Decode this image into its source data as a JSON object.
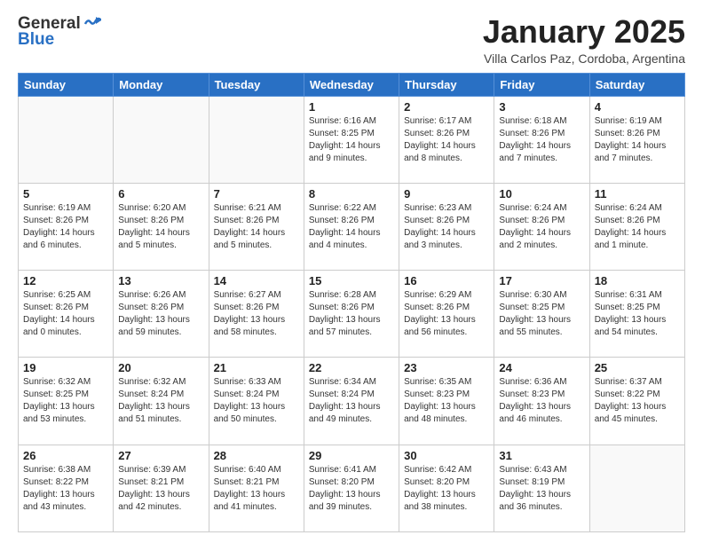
{
  "logo": {
    "general": "General",
    "blue": "Blue"
  },
  "header": {
    "month": "January 2025",
    "location": "Villa Carlos Paz, Cordoba, Argentina"
  },
  "days_of_week": [
    "Sunday",
    "Monday",
    "Tuesday",
    "Wednesday",
    "Thursday",
    "Friday",
    "Saturday"
  ],
  "weeks": [
    [
      {
        "day": "",
        "sunrise": "",
        "sunset": "",
        "daylight": ""
      },
      {
        "day": "",
        "sunrise": "",
        "sunset": "",
        "daylight": ""
      },
      {
        "day": "",
        "sunrise": "",
        "sunset": "",
        "daylight": ""
      },
      {
        "day": "1",
        "sunrise": "Sunrise: 6:16 AM",
        "sunset": "Sunset: 8:25 PM",
        "daylight": "Daylight: 14 hours and 9 minutes."
      },
      {
        "day": "2",
        "sunrise": "Sunrise: 6:17 AM",
        "sunset": "Sunset: 8:26 PM",
        "daylight": "Daylight: 14 hours and 8 minutes."
      },
      {
        "day": "3",
        "sunrise": "Sunrise: 6:18 AM",
        "sunset": "Sunset: 8:26 PM",
        "daylight": "Daylight: 14 hours and 7 minutes."
      },
      {
        "day": "4",
        "sunrise": "Sunrise: 6:19 AM",
        "sunset": "Sunset: 8:26 PM",
        "daylight": "Daylight: 14 hours and 7 minutes."
      }
    ],
    [
      {
        "day": "5",
        "sunrise": "Sunrise: 6:19 AM",
        "sunset": "Sunset: 8:26 PM",
        "daylight": "Daylight: 14 hours and 6 minutes."
      },
      {
        "day": "6",
        "sunrise": "Sunrise: 6:20 AM",
        "sunset": "Sunset: 8:26 PM",
        "daylight": "Daylight: 14 hours and 5 minutes."
      },
      {
        "day": "7",
        "sunrise": "Sunrise: 6:21 AM",
        "sunset": "Sunset: 8:26 PM",
        "daylight": "Daylight: 14 hours and 5 minutes."
      },
      {
        "day": "8",
        "sunrise": "Sunrise: 6:22 AM",
        "sunset": "Sunset: 8:26 PM",
        "daylight": "Daylight: 14 hours and 4 minutes."
      },
      {
        "day": "9",
        "sunrise": "Sunrise: 6:23 AM",
        "sunset": "Sunset: 8:26 PM",
        "daylight": "Daylight: 14 hours and 3 minutes."
      },
      {
        "day": "10",
        "sunrise": "Sunrise: 6:24 AM",
        "sunset": "Sunset: 8:26 PM",
        "daylight": "Daylight: 14 hours and 2 minutes."
      },
      {
        "day": "11",
        "sunrise": "Sunrise: 6:24 AM",
        "sunset": "Sunset: 8:26 PM",
        "daylight": "Daylight: 14 hours and 1 minute."
      }
    ],
    [
      {
        "day": "12",
        "sunrise": "Sunrise: 6:25 AM",
        "sunset": "Sunset: 8:26 PM",
        "daylight": "Daylight: 14 hours and 0 minutes."
      },
      {
        "day": "13",
        "sunrise": "Sunrise: 6:26 AM",
        "sunset": "Sunset: 8:26 PM",
        "daylight": "Daylight: 13 hours and 59 minutes."
      },
      {
        "day": "14",
        "sunrise": "Sunrise: 6:27 AM",
        "sunset": "Sunset: 8:26 PM",
        "daylight": "Daylight: 13 hours and 58 minutes."
      },
      {
        "day": "15",
        "sunrise": "Sunrise: 6:28 AM",
        "sunset": "Sunset: 8:26 PM",
        "daylight": "Daylight: 13 hours and 57 minutes."
      },
      {
        "day": "16",
        "sunrise": "Sunrise: 6:29 AM",
        "sunset": "Sunset: 8:26 PM",
        "daylight": "Daylight: 13 hours and 56 minutes."
      },
      {
        "day": "17",
        "sunrise": "Sunrise: 6:30 AM",
        "sunset": "Sunset: 8:25 PM",
        "daylight": "Daylight: 13 hours and 55 minutes."
      },
      {
        "day": "18",
        "sunrise": "Sunrise: 6:31 AM",
        "sunset": "Sunset: 8:25 PM",
        "daylight": "Daylight: 13 hours and 54 minutes."
      }
    ],
    [
      {
        "day": "19",
        "sunrise": "Sunrise: 6:32 AM",
        "sunset": "Sunset: 8:25 PM",
        "daylight": "Daylight: 13 hours and 53 minutes."
      },
      {
        "day": "20",
        "sunrise": "Sunrise: 6:32 AM",
        "sunset": "Sunset: 8:24 PM",
        "daylight": "Daylight: 13 hours and 51 minutes."
      },
      {
        "day": "21",
        "sunrise": "Sunrise: 6:33 AM",
        "sunset": "Sunset: 8:24 PM",
        "daylight": "Daylight: 13 hours and 50 minutes."
      },
      {
        "day": "22",
        "sunrise": "Sunrise: 6:34 AM",
        "sunset": "Sunset: 8:24 PM",
        "daylight": "Daylight: 13 hours and 49 minutes."
      },
      {
        "day": "23",
        "sunrise": "Sunrise: 6:35 AM",
        "sunset": "Sunset: 8:23 PM",
        "daylight": "Daylight: 13 hours and 48 minutes."
      },
      {
        "day": "24",
        "sunrise": "Sunrise: 6:36 AM",
        "sunset": "Sunset: 8:23 PM",
        "daylight": "Daylight: 13 hours and 46 minutes."
      },
      {
        "day": "25",
        "sunrise": "Sunrise: 6:37 AM",
        "sunset": "Sunset: 8:22 PM",
        "daylight": "Daylight: 13 hours and 45 minutes."
      }
    ],
    [
      {
        "day": "26",
        "sunrise": "Sunrise: 6:38 AM",
        "sunset": "Sunset: 8:22 PM",
        "daylight": "Daylight: 13 hours and 43 minutes."
      },
      {
        "day": "27",
        "sunrise": "Sunrise: 6:39 AM",
        "sunset": "Sunset: 8:21 PM",
        "daylight": "Daylight: 13 hours and 42 minutes."
      },
      {
        "day": "28",
        "sunrise": "Sunrise: 6:40 AM",
        "sunset": "Sunset: 8:21 PM",
        "daylight": "Daylight: 13 hours and 41 minutes."
      },
      {
        "day": "29",
        "sunrise": "Sunrise: 6:41 AM",
        "sunset": "Sunset: 8:20 PM",
        "daylight": "Daylight: 13 hours and 39 minutes."
      },
      {
        "day": "30",
        "sunrise": "Sunrise: 6:42 AM",
        "sunset": "Sunset: 8:20 PM",
        "daylight": "Daylight: 13 hours and 38 minutes."
      },
      {
        "day": "31",
        "sunrise": "Sunrise: 6:43 AM",
        "sunset": "Sunset: 8:19 PM",
        "daylight": "Daylight: 13 hours and 36 minutes."
      },
      {
        "day": "",
        "sunrise": "",
        "sunset": "",
        "daylight": ""
      }
    ]
  ]
}
